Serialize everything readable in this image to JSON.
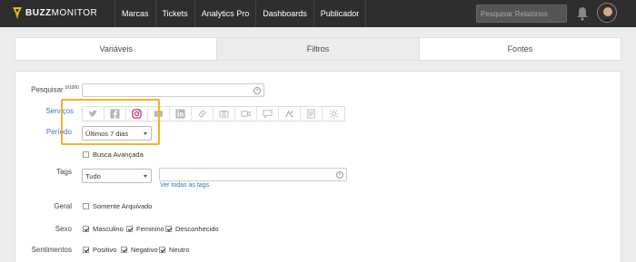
{
  "brand": {
    "name_bold": "BUZZ",
    "name_rest": "MONITOR",
    "accent": "#f3b324"
  },
  "nav": [
    {
      "label": "Marcas"
    },
    {
      "label": "Tickets"
    },
    {
      "label": "Analytics Pro"
    },
    {
      "label": "Dashboards"
    },
    {
      "label": "Publicador"
    }
  ],
  "search": {
    "placeholder": "Pesquisar Relatórios"
  },
  "tabs": [
    {
      "label": "Variáveis"
    },
    {
      "label": "Filtros"
    },
    {
      "label": "Fontes"
    }
  ],
  "form": {
    "pesquisar": {
      "label": "Pesquisar",
      "counter": "0/1000",
      "value": ""
    },
    "servicos": {
      "label": "Serviços",
      "icons": [
        "twitter-icon",
        "facebook-icon",
        "instagram-icon",
        "youtube-icon",
        "linkedin-icon",
        "ticket-icon",
        "camera-icon",
        "video-icon",
        "chat-icon",
        "reclame-icon",
        "document-icon",
        "sun-icon"
      ]
    },
    "periodo": {
      "label": "Período",
      "selected": "Últimos 7 dias"
    },
    "busca_avancada": {
      "label": "Busca Avançada",
      "checked": false
    },
    "tags": {
      "label": "Tags",
      "selected": "Tudo",
      "value": "",
      "link": "Ver todas as tags"
    },
    "geral": {
      "label": "Geral",
      "option": "Somente Arquivado",
      "checked": false
    },
    "sexo": {
      "label": "Sexo",
      "options": [
        {
          "label": "Masculino",
          "checked": true
        },
        {
          "label": "Feminino",
          "checked": true
        },
        {
          "label": "Desconhecido",
          "checked": true
        }
      ]
    },
    "sentimentos": {
      "label": "Sentimentos",
      "options": [
        {
          "label": "Positivo",
          "checked": true
        },
        {
          "label": "Negativo",
          "checked": true
        },
        {
          "label": "Neutro",
          "checked": true
        }
      ]
    }
  }
}
